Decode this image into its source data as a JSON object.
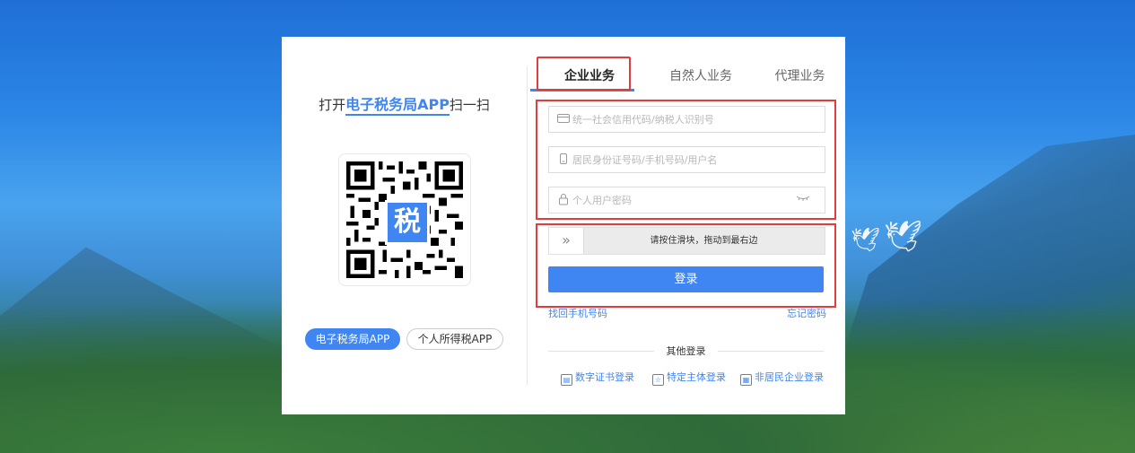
{
  "left": {
    "scan_prefix": "打开",
    "scan_highlight": "电子税务局APP",
    "scan_suffix": "扫一扫",
    "qr_center_char": "税",
    "buttons": [
      "电子税务局APP",
      "个人所得税APP"
    ]
  },
  "tabs": [
    {
      "label": "企业业务",
      "active": true
    },
    {
      "label": "自然人业务",
      "active": false
    },
    {
      "label": "代理业务",
      "active": false
    }
  ],
  "fields": {
    "credit_code": {
      "placeholder": "统一社会信用代码/纳税人识别号",
      "icon": "id-card-icon"
    },
    "identity": {
      "placeholder": "居民身份证号码/手机号码/用户名",
      "icon": "phone-icon"
    },
    "password": {
      "placeholder": "个人用户密码",
      "icon": "lock-icon"
    }
  },
  "slider": {
    "text": "请按住滑块，拖动到最右边",
    "handle": "»"
  },
  "login_label": "登录",
  "links": {
    "retrieve_phone": "找回手机号码",
    "forgot_password": "忘记密码"
  },
  "other_login": {
    "label": "其他登录",
    "options": [
      "数字证书登录",
      "特定主体登录",
      "非居民企业登录"
    ]
  },
  "colors": {
    "accent": "#3f86f3",
    "highlight_box": "#e23d3d"
  }
}
